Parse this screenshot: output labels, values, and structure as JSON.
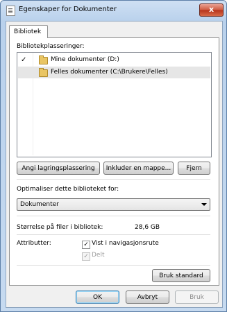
{
  "window": {
    "title": "Egenskaper for Dokumenter",
    "close_glyph": "x"
  },
  "tabs": [
    {
      "label": "Bibliotek",
      "selected": true
    }
  ],
  "library": {
    "locations_label": "Bibliotekplasseringer:",
    "locations": [
      {
        "check": "✓",
        "text": "Mine dokumenter (D:)",
        "selected": false
      },
      {
        "check": "",
        "text": "Felles dokumenter (C:\\Brukere\\Felles)",
        "selected": true
      }
    ],
    "buttons": {
      "set_save_location": "Angi lagringsplassering",
      "include_folder": "Inkluder en mappe...",
      "remove": "Fjern"
    },
    "optimize_label": "Optimaliser dette biblioteket for:",
    "optimize_value": "Dokumenter",
    "size_label": "Størrelse på filer i bibliotek:",
    "size_value": "28,6 GB",
    "attributes_label": "Attributter:",
    "attributes": [
      {
        "label": "Vist i navigasjonsrute",
        "checked": true,
        "enabled": true
      },
      {
        "label": "Delt",
        "checked": true,
        "enabled": false
      }
    ],
    "restore_defaults": "Bruk standard"
  },
  "footer": {
    "ok": "OK",
    "cancel": "Avbryt",
    "apply": "Bruk"
  },
  "colors": {
    "title_bar": "#b9d1ec",
    "close_button": "#cf5a3f",
    "selection": "#e6e6e6"
  }
}
